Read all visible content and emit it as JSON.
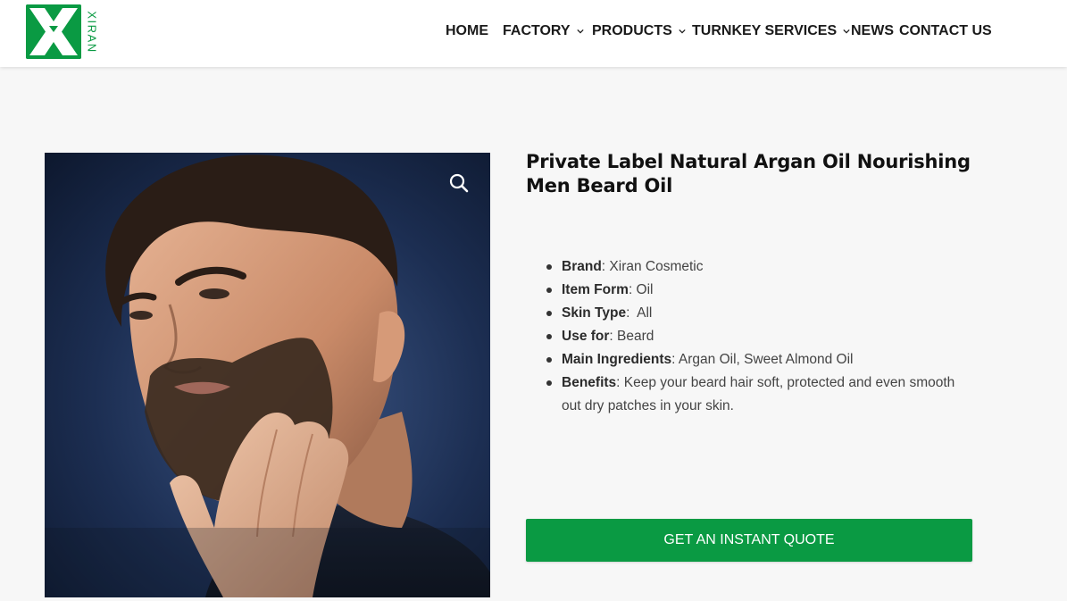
{
  "brand": {
    "logo_text": "XIRAN",
    "accent_color": "#0a9a43"
  },
  "nav": {
    "items": [
      {
        "label": "HOME",
        "has_dropdown": false
      },
      {
        "label": "FACTORY",
        "has_dropdown": true
      },
      {
        "label": "PRODUCTS",
        "has_dropdown": true
      },
      {
        "label": "TURNKEY SERVICES",
        "has_dropdown": true
      },
      {
        "label": "NEWS",
        "has_dropdown": false
      },
      {
        "label": "CONTACT US",
        "has_dropdown": false
      }
    ],
    "dropdown_icon": "chevron-down-icon"
  },
  "product": {
    "title": "Private Label Natural Argan Oil Nourishing Men Beard Oil",
    "image_icon": "zoom-icon",
    "specs": [
      {
        "label": "Brand",
        "value": ": Xiran Cosmetic"
      },
      {
        "label": "Item Form",
        "value": ": Oil"
      },
      {
        "label": "Skin Type",
        "value": ":  All"
      },
      {
        "label": "Use for",
        "value": ": Beard"
      },
      {
        "label": "Main Ingredients",
        "value": ": Argan Oil, Sweet Almond Oil"
      },
      {
        "label": "Benefits",
        "value": ": Keep your beard hair soft, protected and even smooth out dry patches in your skin."
      }
    ],
    "cta_label": "GET AN INSTANT QUOTE"
  }
}
